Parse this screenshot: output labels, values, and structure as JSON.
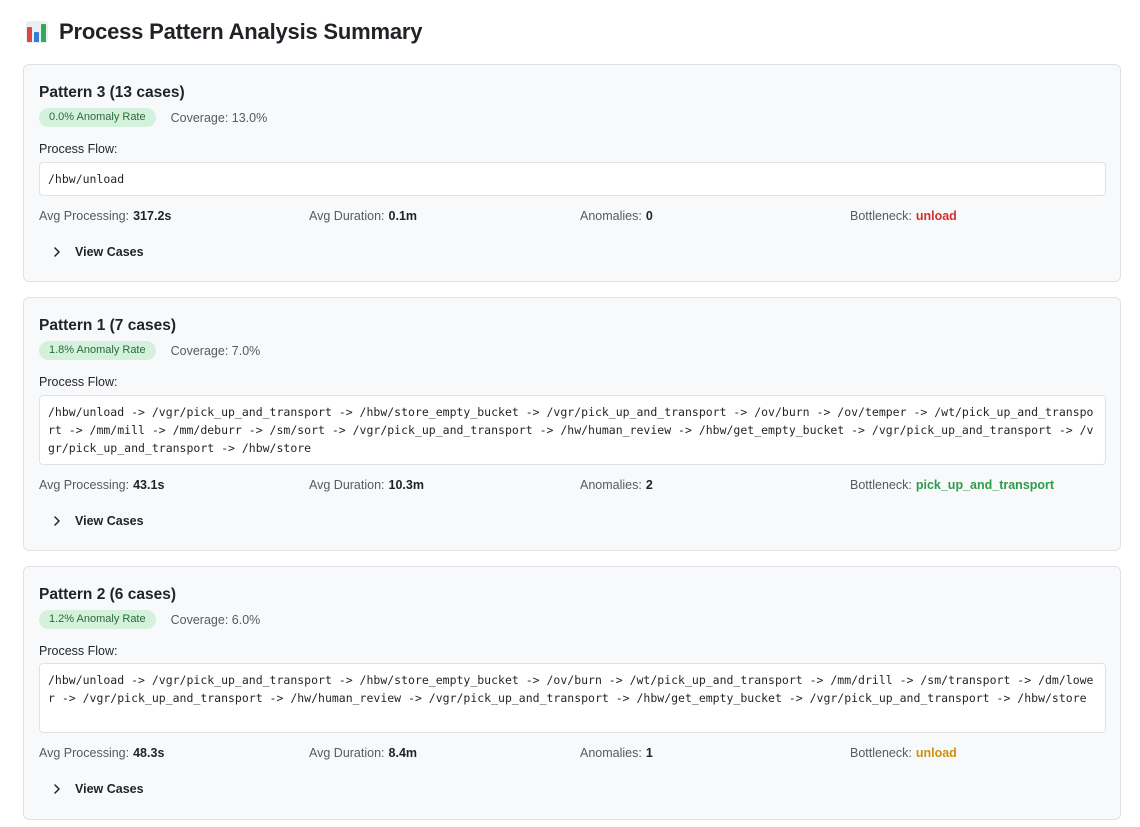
{
  "header": {
    "icon": "bar-chart-icon",
    "title": "Process Pattern Analysis Summary"
  },
  "labels": {
    "process_flow": "Process Flow:",
    "avg_processing": "Avg Processing:",
    "avg_duration": "Avg Duration:",
    "anomalies": "Anomalies:",
    "bottleneck": "Bottleneck:",
    "view_cases": "View Cases"
  },
  "colors": {
    "badge_bg": "#d4f1dc",
    "bottleneck_red": "#d22f2f",
    "bottleneck_green": "#2e9c4b",
    "bottleneck_amber": "#d09010"
  },
  "patterns": [
    {
      "title": "Pattern 3 (13 cases)",
      "anomaly_badge": "0.0% Anomaly Rate",
      "coverage": "Coverage: 13.0%",
      "flow": "/hbw/unload",
      "avg_processing": "317.2s",
      "avg_duration": "0.1m",
      "anomalies": "0",
      "bottleneck": "unload",
      "bottleneck_color": "#d22f2f"
    },
    {
      "title": "Pattern 1 (7 cases)",
      "anomaly_badge": "1.8% Anomaly Rate",
      "coverage": "Coverage: 7.0%",
      "flow": "/hbw/unload -> /vgr/pick_up_and_transport -> /hbw/store_empty_bucket -> /vgr/pick_up_and_transport -> /ov/burn -> /ov/temper -> /wt/pick_up_and_transport -> /mm/mill -> /mm/deburr -> /sm/sort -> /vgr/pick_up_and_transport -> /hw/human_review -> /hbw/get_empty_bucket -> /vgr/pick_up_and_transport -> /vgr/pick_up_and_transport -> /hbw/store",
      "avg_processing": "43.1s",
      "avg_duration": "10.3m",
      "anomalies": "2",
      "bottleneck": "pick_up_and_transport",
      "bottleneck_color": "#2e9c4b"
    },
    {
      "title": "Pattern 2 (6 cases)",
      "anomaly_badge": "1.2% Anomaly Rate",
      "coverage": "Coverage: 6.0%",
      "flow": "/hbw/unload -> /vgr/pick_up_and_transport -> /hbw/store_empty_bucket -> /ov/burn -> /wt/pick_up_and_transport -> /mm/drill -> /sm/transport -> /dm/lower -> /vgr/pick_up_and_transport -> /hw/human_review -> /vgr/pick_up_and_transport -> /hbw/get_empty_bucket -> /vgr/pick_up_and_transport -> /hbw/store",
      "avg_processing": "48.3s",
      "avg_duration": "8.4m",
      "anomalies": "1",
      "bottleneck": "unload",
      "bottleneck_color": "#d09010"
    }
  ]
}
